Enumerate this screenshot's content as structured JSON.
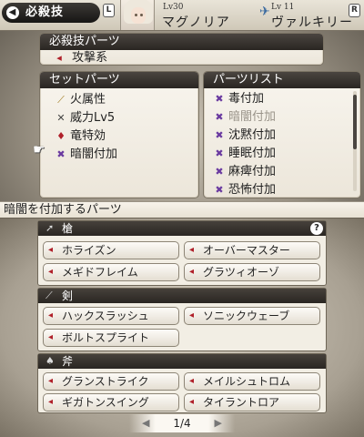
{
  "header": {
    "mode_title": "必殺技",
    "left_button": "L",
    "right_button": "R",
    "character_level": "Lv30",
    "character_name": "マグノリア",
    "job_level": "Lv 11",
    "job_name": "ヴァルキリー"
  },
  "special_parts": {
    "title": "必殺技パーツ",
    "item": "攻撃系"
  },
  "set_parts": {
    "title": "セットパーツ",
    "items": [
      "火属性",
      "威力Lv5",
      "竜特効",
      "暗闇付加"
    ],
    "icons": [
      "sword-icon",
      "crossed-swords-icon",
      "dragon-icon",
      "status-icon"
    ]
  },
  "parts_list": {
    "title": "パーツリスト",
    "items": [
      "毒付加",
      "暗闇付加",
      "沈黙付加",
      "睡眠付加",
      "麻痺付加",
      "恐怖付加"
    ]
  },
  "help_text": "暗闇を付加するパーツ",
  "categories": [
    {
      "name": "槍",
      "icon": "spear-icon",
      "skills": [
        "ホライズン",
        "オーバーマスター",
        "メギドフレイム",
        "グラツィオーゾ"
      ]
    },
    {
      "name": "剣",
      "icon": "sword-icon",
      "skills": [
        "ハックスラッシュ",
        "ソニックウェーブ",
        "ボルトスプライト"
      ]
    },
    {
      "name": "斧",
      "icon": "axe-icon",
      "skills": [
        "グランストライク",
        "メイルシュトロム",
        "ギガトンスイング",
        "タイラントロア"
      ]
    }
  ],
  "help_button": "?",
  "pager": "1/4",
  "colors": {
    "accent_dark": "#2a2622",
    "panel_bg": "#f8f5ee",
    "status_purple": "#6a3aa0",
    "icon_red": "#b0202a"
  }
}
